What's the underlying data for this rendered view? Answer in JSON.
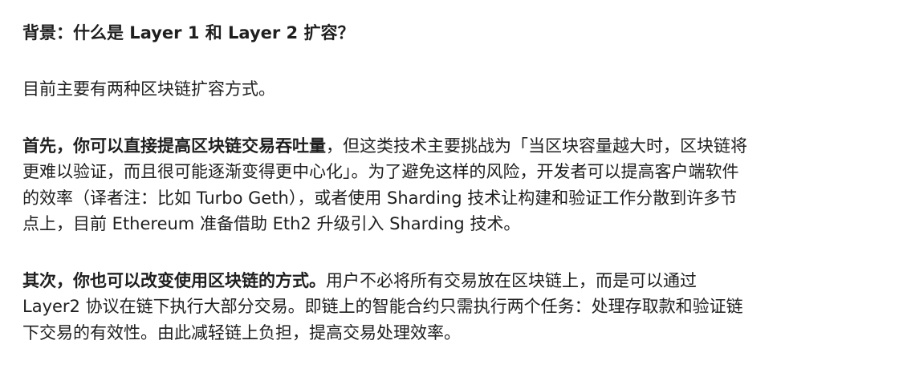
{
  "article": {
    "heading": "背景：什么是 Layer 1 和 Layer 2 扩容？",
    "intro": "目前主要有两种区块链扩容方式。",
    "first": {
      "lead": "首先，你可以直接提高区块链交易吞吐量",
      "lines": [
        "，但这类技术主要挑战为「当区块容量越大时，区块链将",
        "更难以验证，而且很可能逐渐变得更中心化」。为了避免这样的风险，开发者可以提高客户端软件",
        "的效率（译者注：比如 Turbo Geth），或者使用 Sharding 技术让构建和验证工作分散到许多节",
        "点上，目前 Ethereum 准备借助 Eth2 升级引入 Sharding 技术。"
      ]
    },
    "second": {
      "lead": "其次，你也可以改变使用区块链的方式。",
      "lines": [
        "用户不必将所有交易放在区块链上，而是可以通过",
        "Layer2 协议在链下执行大部分交易。即链上的智能合约只需执行两个任务：处理存取款和验证链",
        "下交易的有效性。由此减轻链上负担，提高交易处理效率。"
      ]
    }
  }
}
